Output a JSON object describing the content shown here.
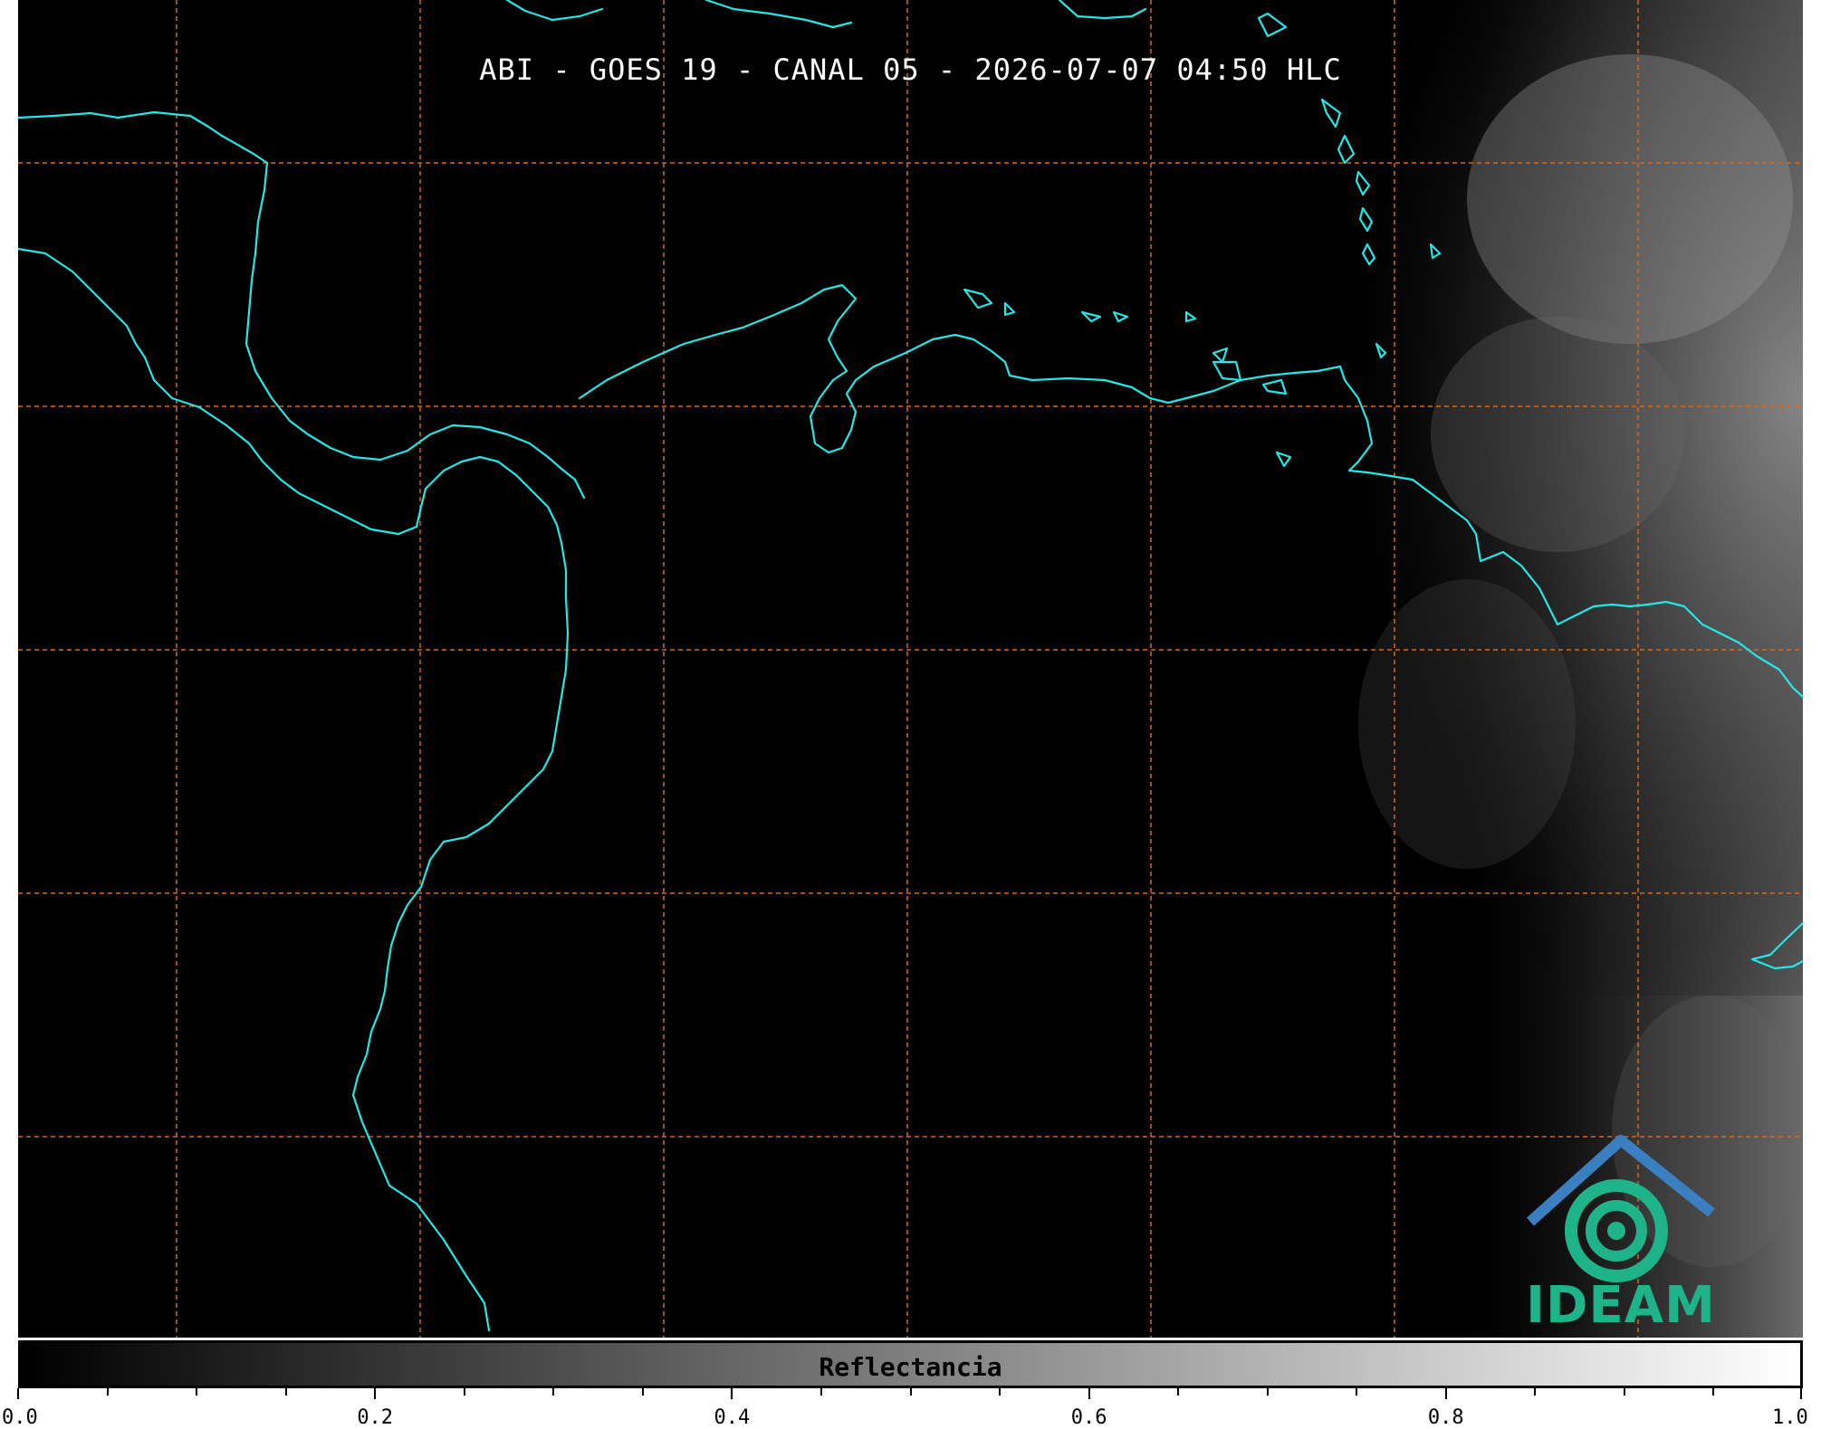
{
  "title": "ABI - GOES 19 - CANAL 05 - 2026-07-07 04:50 HLC",
  "logo": {
    "text": "IDEAM"
  },
  "colorbar": {
    "label": "Reflectancia",
    "range": [
      0.0,
      1.0
    ],
    "tick_labels": [
      "0.0",
      "0.2",
      "0.4",
      "0.6",
      "0.8",
      "1.0"
    ],
    "minor_step": 0.05
  },
  "colors": {
    "coastline": "#26e6e6",
    "gridline": "#d26a1e",
    "background": "#000000",
    "logo_primary": "#1fb38a",
    "logo_roof": "#3a7fc0"
  }
}
